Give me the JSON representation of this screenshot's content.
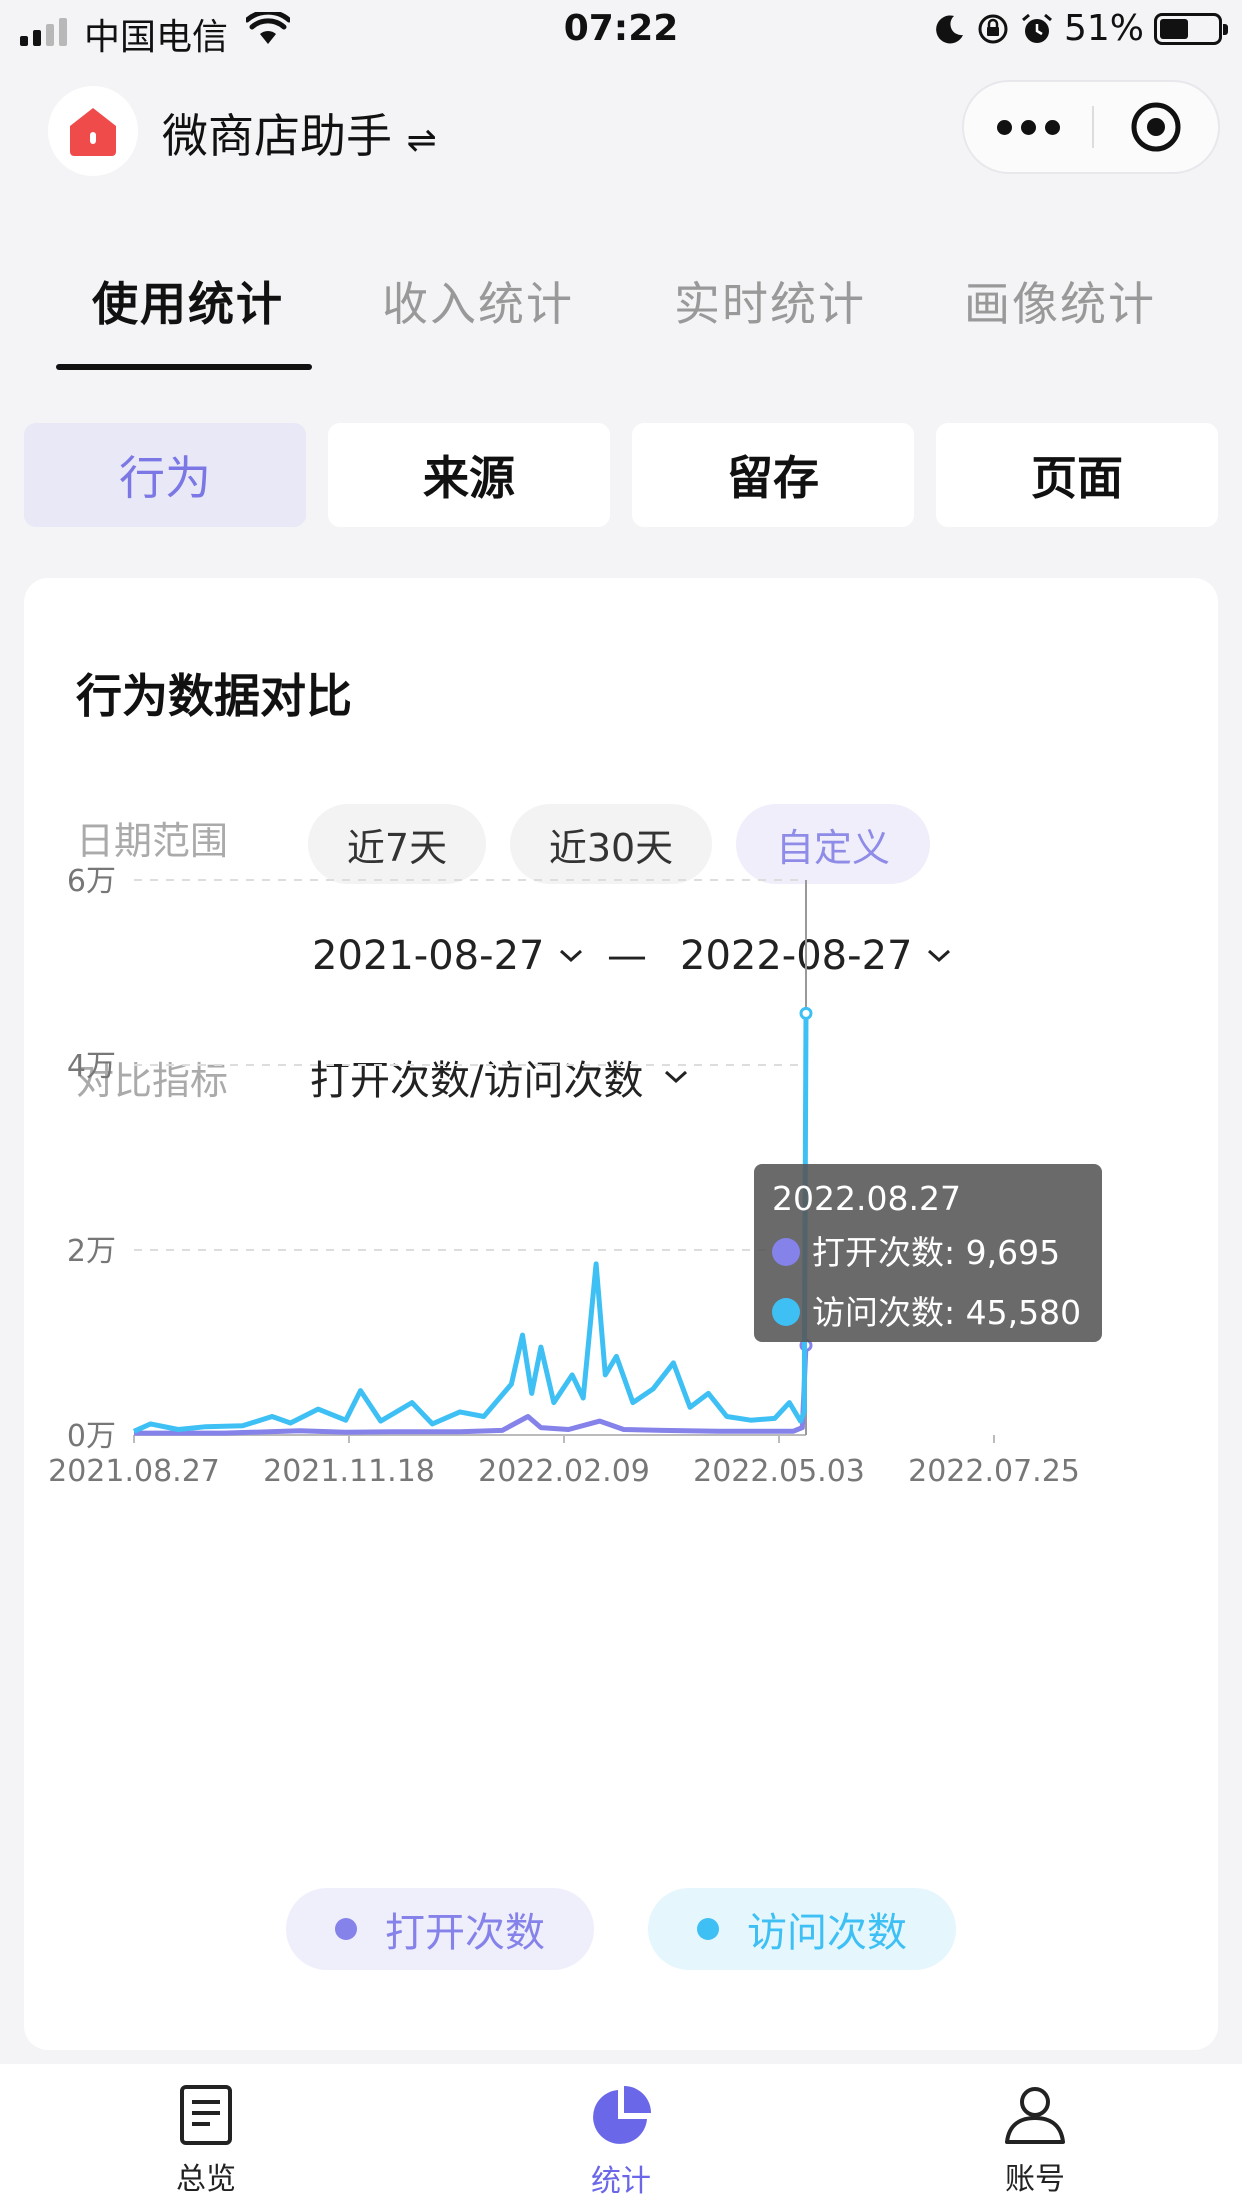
{
  "status_bar": {
    "carrier": "中国电信",
    "time": "07:22",
    "battery": "51%",
    "battery_level": 0.51
  },
  "header": {
    "app_name": "微商店助手",
    "switch_glyph": "⇌",
    "logo_icon": "shop-icon",
    "brand_color": "#f04b4b"
  },
  "main_tabs": [
    {
      "label": "使用统计",
      "active": true
    },
    {
      "label": "收入统计",
      "active": false
    },
    {
      "label": "实时统计",
      "active": false
    },
    {
      "label": "画像统计",
      "active": false
    }
  ],
  "sub_tabs": [
    {
      "label": "行为",
      "active": true
    },
    {
      "label": "来源",
      "active": false
    },
    {
      "label": "留存",
      "active": false
    },
    {
      "label": "页面",
      "active": false
    }
  ],
  "card": {
    "title": "行为数据对比",
    "date_range_label": "日期范围",
    "presets": [
      {
        "label": "近7天",
        "active": false
      },
      {
        "label": "近30天",
        "active": false
      },
      {
        "label": "自定义",
        "active": true
      }
    ],
    "start_date": "2021-08-27",
    "separator": "—",
    "end_date": "2022-08-27",
    "metric_label": "对比指标",
    "metric_value": "打开次数/访问次数"
  },
  "chart_data": {
    "type": "line",
    "y_ticks": [
      "6万",
      "4万",
      "2万",
      "0万"
    ],
    "y_tick_values": [
      60000,
      40000,
      20000,
      0
    ],
    "ylim": [
      0,
      60000
    ],
    "x_ticks": [
      "2021.08.27",
      "2021.11.18",
      "2022.02.09",
      "2022.05.03",
      "2022.07.25"
    ],
    "x_range": [
      "2021-08-27",
      "2022-08-27"
    ],
    "grid": true,
    "series": [
      {
        "name": "打开次数",
        "color": "#8582ea",
        "points": [
          [
            "2021-08-27",
            200
          ],
          [
            "2021-10-15",
            200
          ],
          [
            "2021-11-25",
            450
          ],
          [
            "2021-12-20",
            300
          ],
          [
            "2022-01-15",
            350
          ],
          [
            "2022-02-20",
            350
          ],
          [
            "2022-03-15",
            500
          ],
          [
            "2022-03-29",
            2000
          ],
          [
            "2022-04-05",
            800
          ],
          [
            "2022-04-20",
            600
          ],
          [
            "2022-05-07",
            1500
          ],
          [
            "2022-05-20",
            600
          ],
          [
            "2022-06-10",
            500
          ],
          [
            "2022-07-10",
            400
          ],
          [
            "2022-08-20",
            400
          ],
          [
            "2022-08-25",
            800
          ],
          [
            "2022-08-27",
            9695
          ]
        ]
      },
      {
        "name": "访问次数",
        "color": "#3ec0f5",
        "points": [
          [
            "2021-08-27",
            400
          ],
          [
            "2021-09-05",
            1200
          ],
          [
            "2021-09-20",
            600
          ],
          [
            "2021-10-05",
            900
          ],
          [
            "2021-10-25",
            1000
          ],
          [
            "2021-11-10",
            2000
          ],
          [
            "2021-11-20",
            1300
          ],
          [
            "2021-12-05",
            2800
          ],
          [
            "2021-12-20",
            1600
          ],
          [
            "2021-12-28",
            4800
          ],
          [
            "2022-01-08",
            1500
          ],
          [
            "2022-01-25",
            3500
          ],
          [
            "2022-02-05",
            1200
          ],
          [
            "2022-02-20",
            2500
          ],
          [
            "2022-03-05",
            2000
          ],
          [
            "2022-03-20",
            5500
          ],
          [
            "2022-03-26",
            10800
          ],
          [
            "2022-03-31",
            4500
          ],
          [
            "2022-04-05",
            9500
          ],
          [
            "2022-04-12",
            3500
          ],
          [
            "2022-04-22",
            6500
          ],
          [
            "2022-04-28",
            4000
          ],
          [
            "2022-05-05",
            18500
          ],
          [
            "2022-05-10",
            6500
          ],
          [
            "2022-05-16",
            8500
          ],
          [
            "2022-05-25",
            3500
          ],
          [
            "2022-06-05",
            5000
          ],
          [
            "2022-06-16",
            7800
          ],
          [
            "2022-06-25",
            3000
          ],
          [
            "2022-07-05",
            4500
          ],
          [
            "2022-07-15",
            2000
          ],
          [
            "2022-07-28",
            1600
          ],
          [
            "2022-08-10",
            1800
          ],
          [
            "2022-08-18",
            3500
          ],
          [
            "2022-08-24",
            1500
          ],
          [
            "2022-08-26",
            2500
          ],
          [
            "2022-08-27",
            45580
          ]
        ]
      }
    ],
    "tooltip": {
      "date": "2022.08.27",
      "open_label": "打开次数: 9,695",
      "visit_label": "访问次数: 45,580"
    },
    "legend": [
      {
        "label": "打开次数",
        "color": "#8582ea",
        "bg": "#efeefb"
      },
      {
        "label": "访问次数",
        "color": "#3ec0f5",
        "bg": "#e6f6fd"
      }
    ]
  },
  "bottom_nav": [
    {
      "label": "总览",
      "icon": "document-icon",
      "active": false
    },
    {
      "label": "统计",
      "icon": "pie-chart-icon",
      "active": true
    },
    {
      "label": "账号",
      "icon": "user-icon",
      "active": false
    }
  ]
}
